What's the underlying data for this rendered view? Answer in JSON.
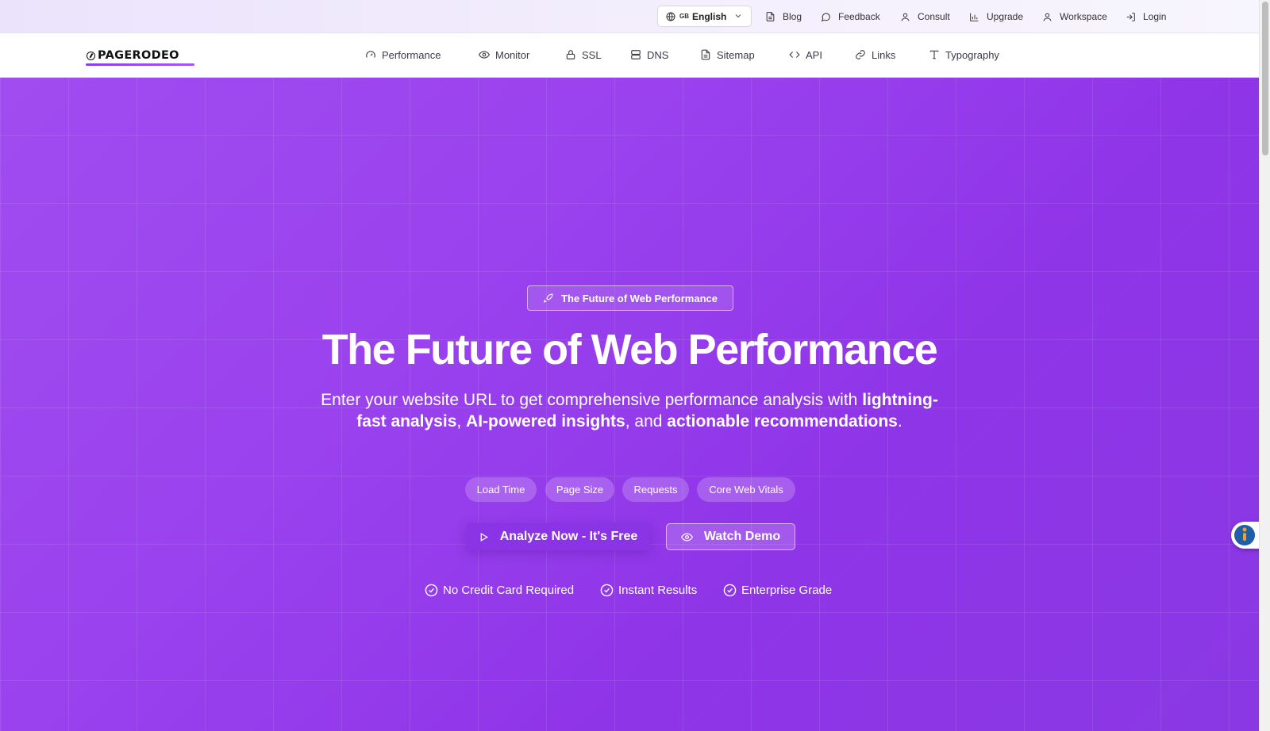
{
  "topbar": {
    "language": {
      "flag": "GB",
      "label": "English"
    },
    "links": [
      {
        "label": "Blog",
        "icon": "document-icon"
      },
      {
        "label": "Feedback",
        "icon": "chat-bubble-icon"
      },
      {
        "label": "Consult",
        "icon": "user-icon"
      },
      {
        "label": "Upgrade",
        "icon": "bar-chart-icon"
      },
      {
        "label": "Workspace",
        "icon": "user-icon"
      },
      {
        "label": "Login",
        "icon": "login-icon"
      }
    ]
  },
  "nav": {
    "logo": "PAGERODEO",
    "items": [
      {
        "label": "Performance",
        "icon": "gauge-icon"
      },
      {
        "label": "Monitor",
        "icon": "eye-icon"
      },
      {
        "label": "SSL",
        "icon": "lock-icon"
      },
      {
        "label": "DNS",
        "icon": "server-icon"
      },
      {
        "label": "Sitemap",
        "icon": "document-icon"
      },
      {
        "label": "API",
        "icon": "code-icon"
      },
      {
        "label": "Links",
        "icon": "link-icon"
      },
      {
        "label": "Typography",
        "icon": "type-icon"
      }
    ]
  },
  "hero": {
    "badge": "The Future of Web Performance",
    "title": "The Future of Web Performance",
    "subtitle_pre": "Enter your website URL to get comprehensive performance analysis with ",
    "subtitle_b1": "lightning-fast analysis",
    "subtitle_sep1": ", ",
    "subtitle_b2": "AI-powered insights",
    "subtitle_sep2": ", and ",
    "subtitle_b3": "actionable recommendations",
    "subtitle_end": ".",
    "chips": [
      "Load Time",
      "Page Size",
      "Requests",
      "Core Web Vitals"
    ],
    "primary_button": "Analyze Now - It's Free",
    "secondary_button": "Watch Demo",
    "checks": [
      "No Credit Card Required",
      "Instant Results",
      "Enterprise Grade"
    ]
  },
  "colors": {
    "hero_start": "#a04cf0",
    "hero_end": "#8a38e4",
    "accent": "#8b3cf0",
    "a11y_button": "#1f5fa8"
  }
}
